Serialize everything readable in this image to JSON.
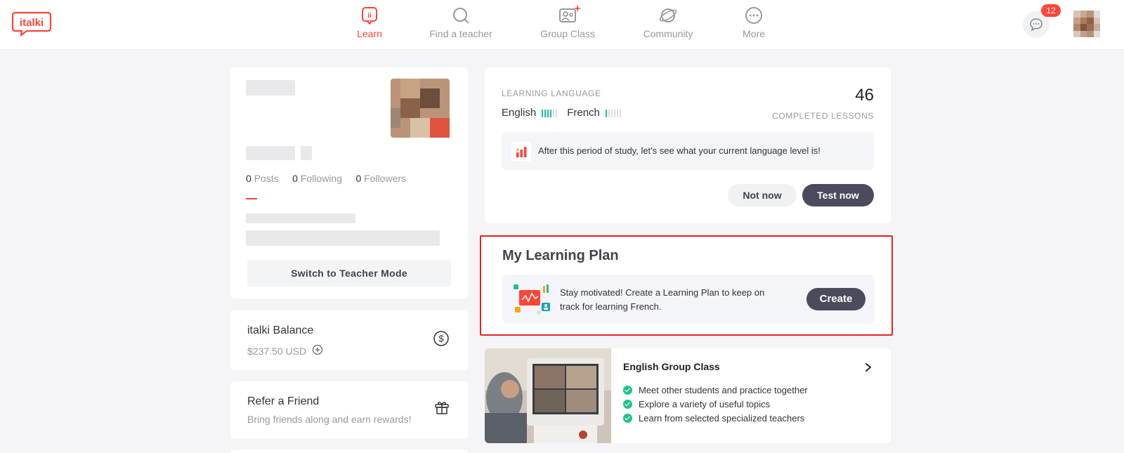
{
  "brand": {
    "logo_text": "italki",
    "accent": "#ff4438"
  },
  "nav": {
    "items": [
      {
        "label": "Learn",
        "icon": "learn-icon",
        "active": true
      },
      {
        "label": "Find a teacher",
        "icon": "search-icon",
        "active": false
      },
      {
        "label": "Group Class",
        "icon": "group-class-icon",
        "active": false
      },
      {
        "label": "Community",
        "icon": "community-icon",
        "active": false
      },
      {
        "label": "More",
        "icon": "more-icon",
        "active": false
      }
    ]
  },
  "header": {
    "message_badge": "12"
  },
  "profile": {
    "posts_count": "0",
    "posts_label": "Posts",
    "following_count": "0",
    "following_label": "Following",
    "followers_count": "0",
    "followers_label": "Followers",
    "switch_button": "Switch to Teacher Mode"
  },
  "balance": {
    "title": "italki Balance",
    "amount": "$237.50 USD"
  },
  "refer": {
    "title": "Refer a Friend",
    "subtitle": "Bring friends along and earn rewards!"
  },
  "learning": {
    "label": "LEARNING LANGUAGE",
    "languages": [
      {
        "name": "English",
        "level": 4,
        "max": 6
      },
      {
        "name": "French",
        "level": 1,
        "max": 6
      }
    ],
    "completed_count": "46",
    "completed_label": "COMPLETED LESSONS",
    "notice": "After this period of study, let's see what your current language level is!",
    "not_now": "Not now",
    "test_now": "Test now"
  },
  "plan": {
    "title": "My Learning Plan",
    "text": "Stay motivated! Create a Learning Plan to keep on track for learning French.",
    "create": "Create"
  },
  "group_class": {
    "title": "English Group Class",
    "bullets": [
      "Meet other students and practice together",
      "Explore a variety of useful topics",
      "Learn from selected specialized teachers"
    ]
  }
}
